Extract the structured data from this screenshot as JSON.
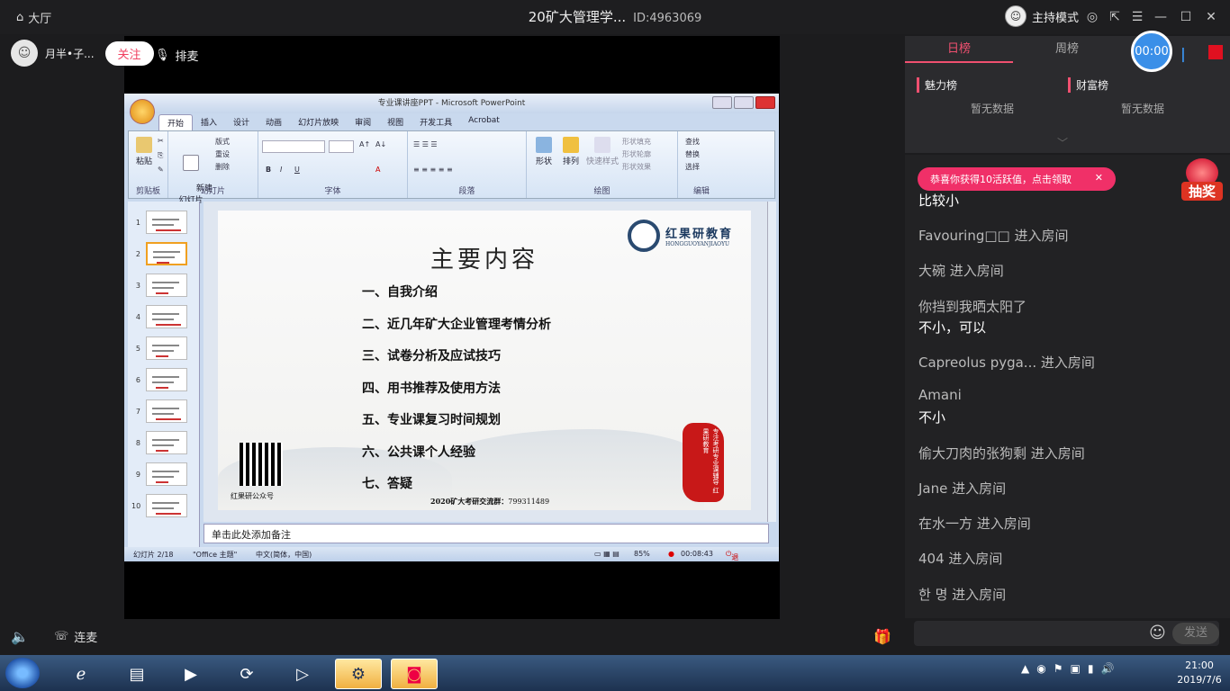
{
  "topbar": {
    "home_label": "大厅",
    "room_title": "20矿大管理学...",
    "room_id": "ID:4963069",
    "host_mode_label": "主持模式"
  },
  "streamer": {
    "name": "月半•子...",
    "follow_label": "关注",
    "queue_label": "排麦"
  },
  "ppt": {
    "window_title": "专业课讲座PPT - Microsoft PowerPoint",
    "tabs": [
      "开始",
      "插入",
      "设计",
      "动画",
      "幻灯片放映",
      "审阅",
      "视图",
      "开发工具",
      "Acrobat"
    ],
    "ribbon_groups": [
      "剪贴板",
      "幻灯片",
      "字体",
      "段落",
      "绘图",
      "编辑"
    ],
    "ribbon_buttons": {
      "paste": "粘贴",
      "new_slide": "新建\n幻灯片",
      "layout": "版式",
      "reset": "重设",
      "delete": "删除",
      "shape": "形状",
      "arrange": "排列",
      "quick_style": "快速样式",
      "shape_fill": "形状填充",
      "shape_outline": "形状轮廓",
      "shape_effect": "形状效果",
      "find": "查找",
      "replace": "替换",
      "select": "选择"
    },
    "thumb_numbers": [
      "1",
      "2",
      "3",
      "4",
      "5",
      "6",
      "7",
      "8",
      "9",
      "10"
    ],
    "notes_placeholder": "单击此处添加备注",
    "status": {
      "slide": "幻灯片 2/18",
      "theme": "\"Office 主题\"",
      "lang": "中文(简体，中国)",
      "zoom": "85%",
      "rec_time": "00:08:43",
      "exit_share": "退出分享"
    }
  },
  "slide": {
    "title": "主要内容",
    "items": [
      "一、自我介绍",
      "二、近几年矿大企业管理考情分析",
      "三、试卷分析及应试技巧",
      "四、用书推荐及使用方法",
      "五、专业课复习时间规划",
      "六、公共课个人经验",
      "七、答疑"
    ],
    "logo_cn": "红果研教育",
    "logo_en": "HONGGUOYANJIAOYU",
    "qr_label": "红果研公众号",
    "group_text": "2020矿大考研交流群：",
    "group_number": "799311489",
    "seal_text": "专注考研专业课辅导 红果研教育"
  },
  "ranking": {
    "tab_day": "日榜",
    "tab_week": "周榜",
    "timer": "00:00",
    "charm_label": "魅力榜",
    "wealth_label": "财富榜",
    "charm_empty": "暂无数据",
    "wealth_empty": "暂无数据"
  },
  "chat": {
    "banner": "恭喜你获得10活跃值，点击领取",
    "lottery_label": "抽奖",
    "messages": [
      {
        "text": "比较小",
        "style": "w"
      },
      {
        "text": "Favouring□□ 进入房间",
        "style": "g"
      },
      {
        "text": "大碗 进入房间",
        "style": "g"
      },
      {
        "text": "你挡到我晒太阳了",
        "style": "g"
      },
      {
        "text": "不小，可以",
        "style": "w"
      },
      {
        "text": "Capreolus pyga... 进入房间",
        "style": "g"
      },
      {
        "text": "Amani",
        "style": "g"
      },
      {
        "text": "不小",
        "style": "w"
      },
      {
        "text": "偷大刀肉的张狗剩 进入房间",
        "style": "g"
      },
      {
        "text": "Jane  进入房间",
        "style": "g"
      },
      {
        "text": "在水一方 进入房间",
        "style": "g"
      },
      {
        "text": "404 进入房间",
        "style": "g"
      },
      {
        "text": "한 명 进入房间",
        "style": "g"
      }
    ],
    "send_label": "发送"
  },
  "bottom": {
    "lianmai_label": "连麦"
  },
  "taskbar": {
    "time": "21:00",
    "date": "2019/7/6"
  },
  "colors": {
    "accent": "#f05070",
    "timer": "#3a8fe8",
    "seal": "#c81818"
  }
}
